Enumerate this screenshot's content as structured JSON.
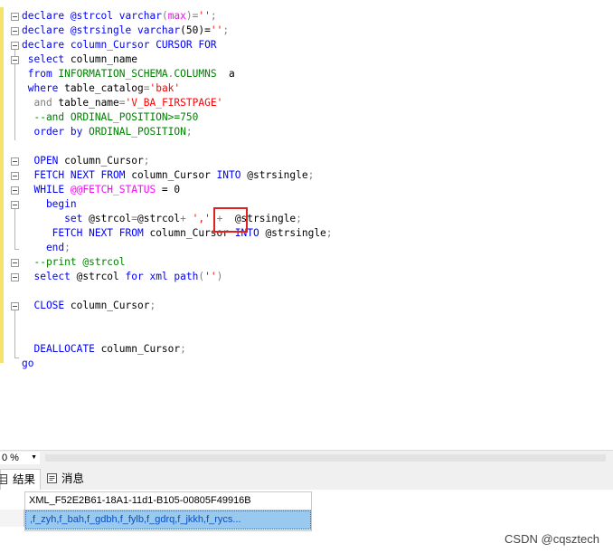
{
  "editor": {
    "lines": [
      [
        {
          "t": "declare @strcol ",
          "c": "kw"
        },
        {
          "t": "varchar",
          "c": "kw"
        },
        {
          "t": "(",
          "c": "op"
        },
        {
          "t": "max",
          "c": "fn"
        },
        {
          "t": ")=",
          "c": "op"
        },
        {
          "t": "''",
          "c": "str"
        },
        {
          "t": ";",
          "c": "op"
        }
      ],
      [
        {
          "t": "declare @strsingle ",
          "c": "kw"
        },
        {
          "t": "varchar",
          "c": "kw"
        },
        {
          "t": "(50)=",
          "c": ""
        },
        {
          "t": "''",
          "c": "str"
        },
        {
          "t": ";",
          "c": "op"
        }
      ],
      [
        {
          "t": "declare column_Cursor ",
          "c": "kw"
        },
        {
          "t": "CURSOR FOR",
          "c": "kw"
        }
      ],
      [
        {
          "t": " select ",
          "c": "kw"
        },
        {
          "t": "column_name",
          "c": ""
        }
      ],
      [
        {
          "t": " from ",
          "c": "kw"
        },
        {
          "t": "INFORMATION_SCHEMA",
          "c": "cm"
        },
        {
          "t": ".",
          "c": "op"
        },
        {
          "t": "COLUMNS",
          "c": "cm"
        },
        {
          "t": "  a",
          "c": ""
        }
      ],
      [
        {
          "t": " where ",
          "c": "kw"
        },
        {
          "t": "table_catalog",
          "c": ""
        },
        {
          "t": "=",
          "c": "op"
        },
        {
          "t": "'bak'",
          "c": "str"
        }
      ],
      [
        {
          "t": "  and ",
          "c": "op"
        },
        {
          "t": "table_name",
          "c": ""
        },
        {
          "t": "=",
          "c": "op"
        },
        {
          "t": "'V_BA_FIRSTPAGE'",
          "c": "str"
        }
      ],
      [
        {
          "t": "  --and ORDINAL_POSITION>=750",
          "c": "cm"
        }
      ],
      [
        {
          "t": "  order by ",
          "c": "kw"
        },
        {
          "t": "ORDINAL_POSITION",
          "c": "cm"
        },
        {
          "t": ";",
          "c": "op"
        }
      ],
      [
        {
          "t": "",
          "c": ""
        }
      ],
      [
        {
          "t": "  OPEN ",
          "c": "kw"
        },
        {
          "t": "column_Cursor",
          "c": ""
        },
        {
          "t": ";",
          "c": "op"
        }
      ],
      [
        {
          "t": "  FETCH NEXT FROM ",
          "c": "kw"
        },
        {
          "t": "column_Cursor ",
          "c": ""
        },
        {
          "t": "INTO ",
          "c": "kw"
        },
        {
          "t": "@strsingle",
          "c": ""
        },
        {
          "t": ";",
          "c": "op"
        }
      ],
      [
        {
          "t": "  WHILE ",
          "c": "kw"
        },
        {
          "t": "@@FETCH_STATUS",
          "c": "fn"
        },
        {
          "t": " = 0",
          "c": ""
        }
      ],
      [
        {
          "t": "    begin",
          "c": "kw"
        }
      ],
      [
        {
          "t": "       set ",
          "c": "kw"
        },
        {
          "t": "@strcol",
          "c": ""
        },
        {
          "t": "=",
          "c": "op"
        },
        {
          "t": "@strcol",
          "c": ""
        },
        {
          "t": "+ ",
          "c": "op"
        },
        {
          "t": "','",
          "c": "str"
        },
        {
          "t": " +  ",
          "c": "op"
        },
        {
          "t": "@strsingle",
          "c": ""
        },
        {
          "t": ";",
          "c": "op"
        }
      ],
      [
        {
          "t": "     FETCH NEXT FROM ",
          "c": "kw"
        },
        {
          "t": "column_Cursor ",
          "c": ""
        },
        {
          "t": "INTO ",
          "c": "kw"
        },
        {
          "t": "@strsingle",
          "c": ""
        },
        {
          "t": ";",
          "c": "op"
        }
      ],
      [
        {
          "t": "    end",
          "c": "kw"
        },
        {
          "t": ";",
          "c": "op"
        }
      ],
      [
        {
          "t": "  --print @strcol",
          "c": "cm"
        }
      ],
      [
        {
          "t": "  select ",
          "c": "kw"
        },
        {
          "t": "@strcol ",
          "c": ""
        },
        {
          "t": "for xml path",
          "c": "kw"
        },
        {
          "t": "(",
          "c": "op"
        },
        {
          "t": "''",
          "c": "str"
        },
        {
          "t": ")",
          "c": "op"
        }
      ],
      [
        {
          "t": "",
          "c": ""
        }
      ],
      [
        {
          "t": "  CLOSE ",
          "c": "kw"
        },
        {
          "t": "column_Cursor",
          "c": ""
        },
        {
          "t": ";",
          "c": "op"
        }
      ],
      [
        {
          "t": "",
          "c": ""
        }
      ],
      [
        {
          "t": "",
          "c": ""
        }
      ],
      [
        {
          "t": "  DEALLOCATE ",
          "c": "kw"
        },
        {
          "t": "column_Cursor",
          "c": ""
        },
        {
          "t": ";",
          "c": "op"
        }
      ],
      [
        {
          "t": "go",
          "c": "kw"
        }
      ]
    ]
  },
  "zoom": {
    "value": "0 %"
  },
  "tabs": {
    "results": "结果",
    "messages": "消息"
  },
  "results": {
    "column_header": "XML_F52E2B61-18A1-11d1-B105-00805F49916B",
    "cell_value": ",f_zyh,f_bah,f_gdbh,f_fylb,f_gdrq,f_jkkh,f_rycs..."
  },
  "watermark": "CSDN @cqsztech"
}
